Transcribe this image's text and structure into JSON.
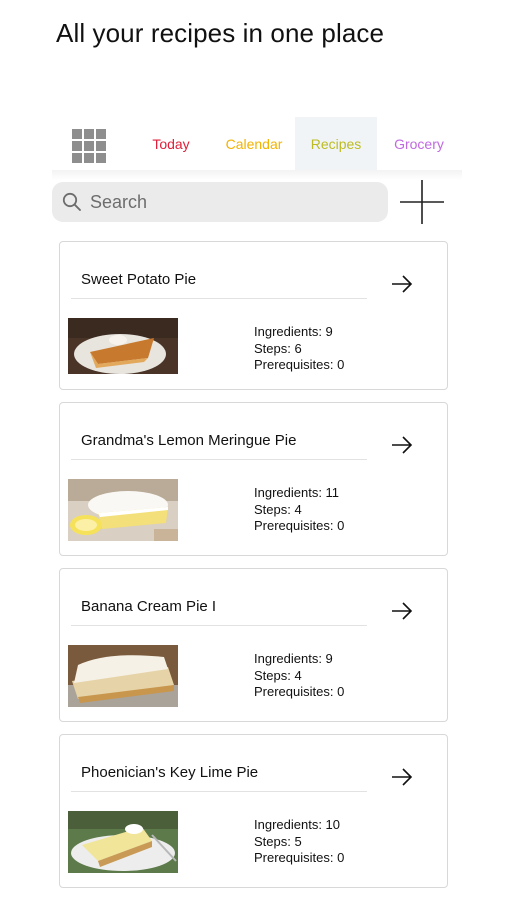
{
  "headline": "All your recipes in one place",
  "tabs": {
    "today": "Today",
    "calendar": "Calendar",
    "recipes": "Recipes",
    "grocery": "Grocery"
  },
  "search": {
    "placeholder": "Search"
  },
  "icons": {
    "menu": "grid-icon",
    "add": "plus-icon",
    "open": "arrow-right-icon",
    "search": "magnifier-icon"
  },
  "colors": {
    "today": "#e0203a",
    "calendar": "#f3b300",
    "recipes": "#bcbc22",
    "grocery": "#c06ae0"
  },
  "recipes": [
    {
      "name": "Sweet Potato Pie",
      "ingredients": "Ingredients: 9",
      "steps": "Steps: 6",
      "prerequisites": "Prerequisites: 0"
    },
    {
      "name": "Grandma's Lemon Meringue Pie",
      "ingredients": "Ingredients: 11",
      "steps": "Steps: 4",
      "prerequisites": "Prerequisites: 0"
    },
    {
      "name": "Banana Cream Pie I",
      "ingredients": "Ingredients: 9",
      "steps": "Steps: 4",
      "prerequisites": "Prerequisites: 0"
    },
    {
      "name": "Phoenician's Key Lime Pie",
      "ingredients": "Ingredients: 10",
      "steps": "Steps: 5",
      "prerequisites": "Prerequisites: 0"
    }
  ]
}
